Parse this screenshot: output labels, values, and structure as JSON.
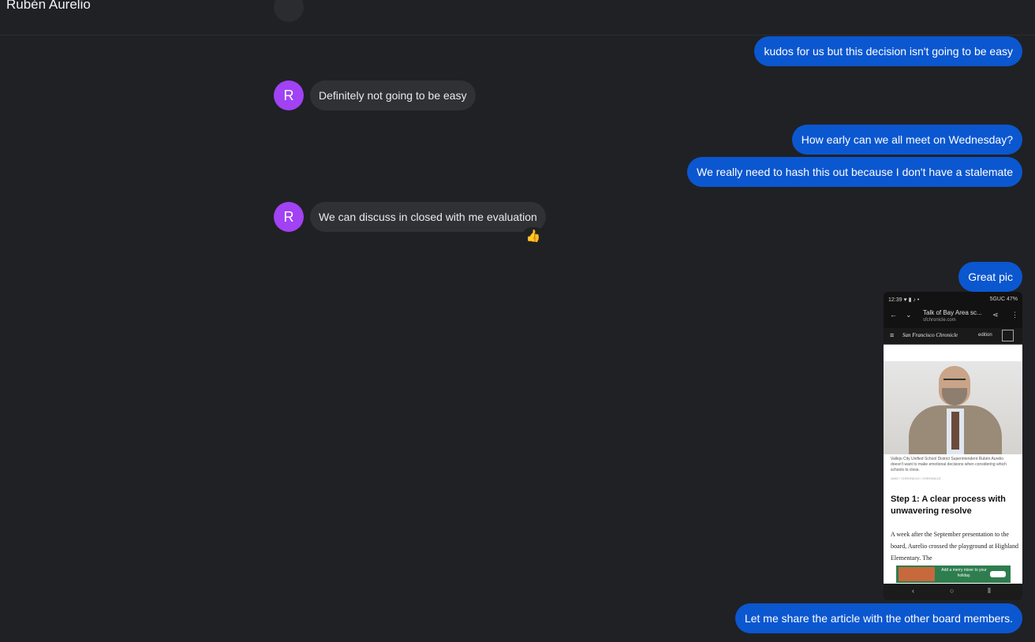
{
  "header": {
    "contact_name": "Rubén Aurelio"
  },
  "colors": {
    "outgoing_bubble": "#0b57d0",
    "incoming_bubble": "#303134",
    "avatar": "#a142f4",
    "background": "#202124"
  },
  "messages": [
    {
      "direction": "outgoing",
      "text": "kudos for us but this decision isn't going to be easy"
    },
    {
      "direction": "incoming",
      "avatar_letter": "R",
      "text": "Definitely not going to be easy"
    },
    {
      "direction": "outgoing",
      "text": "How early can we all meet on Wednesday?"
    },
    {
      "direction": "outgoing",
      "text": "We really need to hash this out because I don't have a stalemate"
    },
    {
      "direction": "incoming",
      "avatar_letter": "R",
      "text": "We can discuss in closed with me evaluation",
      "reaction": "👍"
    },
    {
      "direction": "outgoing",
      "text": "Great pic"
    },
    {
      "direction": "outgoing",
      "type": "image"
    },
    {
      "direction": "outgoing",
      "text": "Let me share the article with the other board members."
    }
  ],
  "attachment": {
    "status_time": "12:39",
    "status_right": "5GUC 47%",
    "site_title": "Talk of Bay Area sc...",
    "site_url": "sfchronicle.com",
    "masthead": "San Francisco Chronicle",
    "edition": "edition",
    "caption": "Vallejo City Unified School District Superintendent Rubén Aurelio doesn't want to make emotional decisions when considering which schools to close.",
    "credit": "JAKE / CHRONICLE / CHRONICLE",
    "headline": "Step 1: A clear process with unwavering resolve",
    "body": "A week after the September presentation to the board, Aurelio crossed the playground at Highland Elementary. The",
    "ad_text": "Add a merry mixer to your holiday."
  }
}
